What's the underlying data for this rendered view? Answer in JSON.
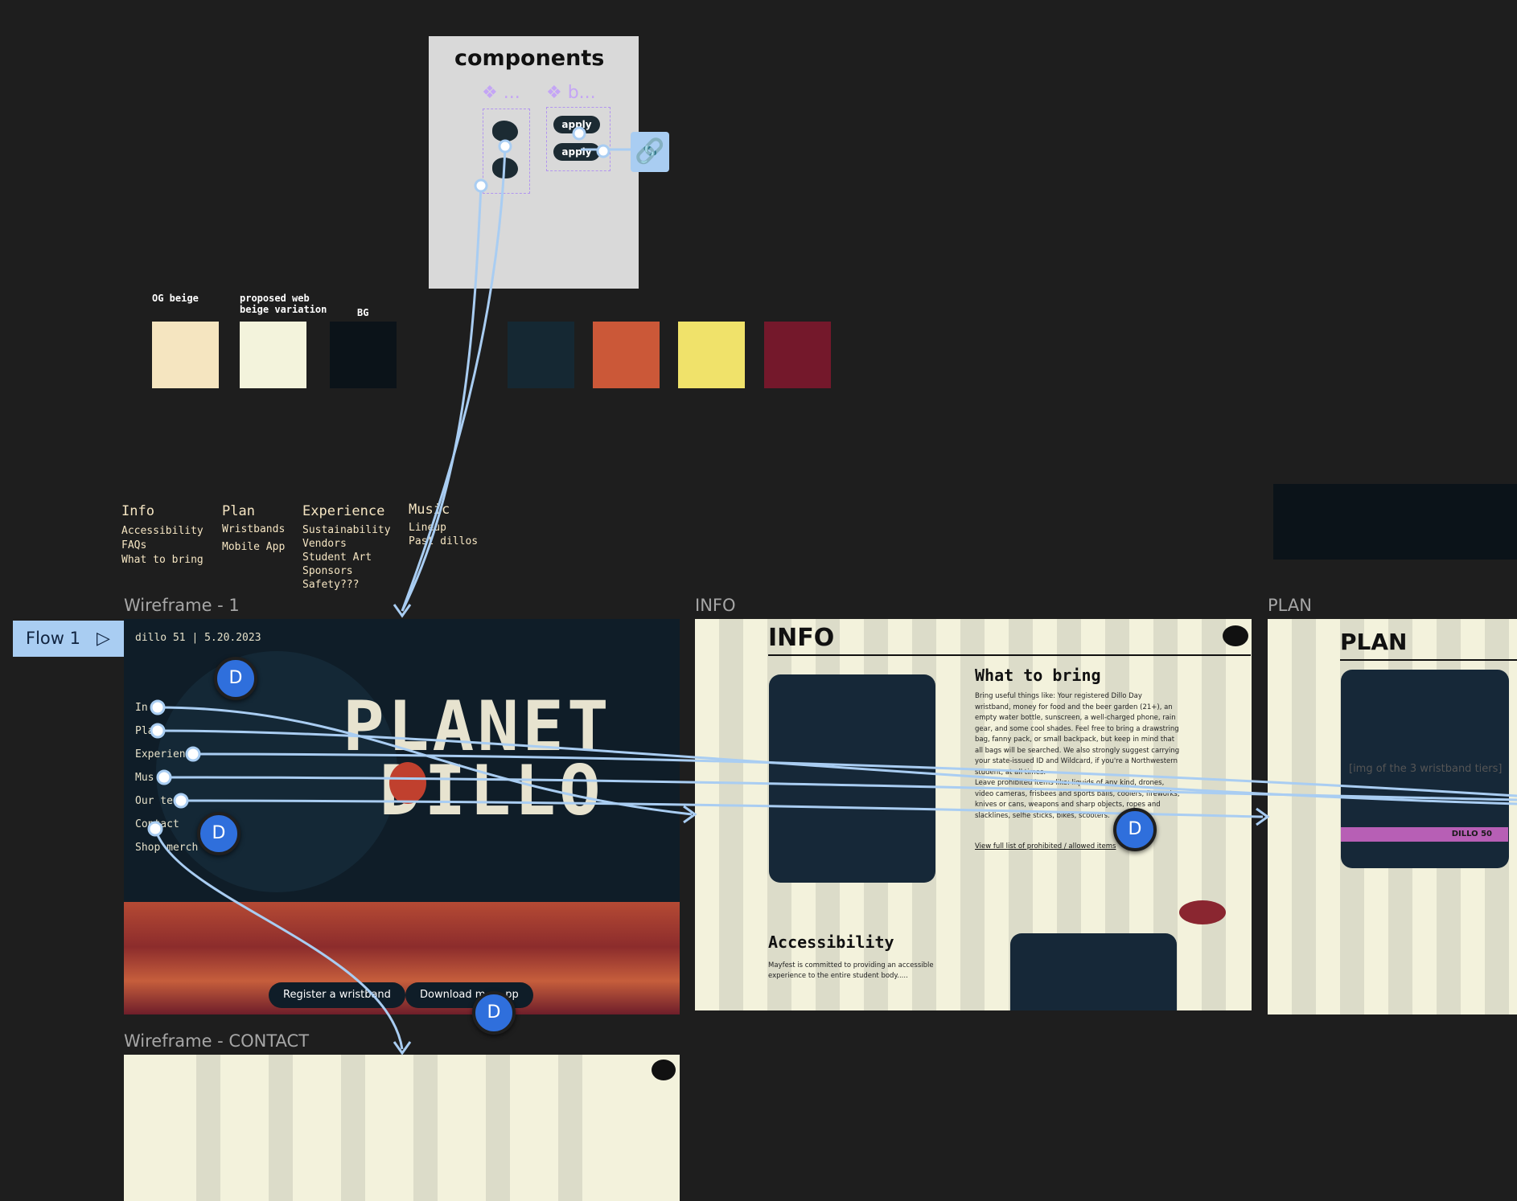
{
  "components": {
    "title": "components",
    "variant_1": "❖ ...",
    "variant_2": "❖ b...",
    "apply_1": "apply",
    "apply_2": "apply",
    "link_icon": "link-icon"
  },
  "swatches": {
    "og_beige_label": "OG beige",
    "proposed_label": "proposed web\nbeige variation",
    "bg_label": "BG",
    "colors": [
      "#f5e5c0",
      "#f3f3dc",
      "#0b1319",
      "#152833",
      "#cb5838",
      "#f0e26a",
      "#74182b"
    ]
  },
  "nav": {
    "info": {
      "heading": "Info",
      "items": [
        "Accessibility",
        "FAQs",
        "What to bring"
      ]
    },
    "plan": {
      "heading": "Plan",
      "items": [
        "Wristbands",
        "Mobile App"
      ]
    },
    "experience": {
      "heading": "Experience",
      "items": [
        "Sustainability",
        "Vendors",
        "Student Art",
        "Sponsors",
        "Safety???"
      ]
    },
    "music": {
      "heading": "Music",
      "items": [
        "Lineup",
        "Past dillos"
      ]
    }
  },
  "frames": {
    "wf1_label": "Wireframe - 1",
    "info_label": "INFO",
    "plan_label": "PLAN",
    "contact_label": "Wireframe - CONTACT"
  },
  "flow": {
    "label": "Flow 1"
  },
  "wf1": {
    "header": "dillo 51  |  5.20.2023",
    "menu": [
      "In",
      "Pla",
      "Experienc",
      "Mus",
      "Our tea",
      "Contact",
      "Shop merch"
    ],
    "planet": "PLANET",
    "dillo": "DILLO",
    "register_btn": "Register a wristband",
    "download_btn": "Download m      pp"
  },
  "info_page": {
    "title": "INFO",
    "what_title": "What to bring",
    "what_body": "Bring useful things like: Your registered Dillo Day wristband, money for food and the beer garden (21+), an empty water bottle, sunscreen, a well-charged phone, rain gear, and some cool shades. Feel free to bring a drawstring bag, fanny pack, or small backpack, but keep in mind that all bags will be searched. We also strongly suggest carrying your state-issued ID and Wildcard, if you're a Northwestern student, at all times.",
    "leave_body": "Leave prohibited items like: liquids of any kind, drones, video cameras, frisbees and sports balls, coolers, fireworks, knives or cans, weapons and sharp objects, ropes and slacklines, selfie sticks, bikes, scooters.",
    "link": "View full list of prohibited / allowed items",
    "access_title": "Accessibility",
    "access_body": "Mayfest is committed to providing an accessible experience to the entire student body....."
  },
  "plan_page": {
    "title": "PLAN",
    "img_note": "[img of the 3 wristband tiers]",
    "band_text": "DILLO 50"
  },
  "avatars": {
    "initial": "D"
  }
}
